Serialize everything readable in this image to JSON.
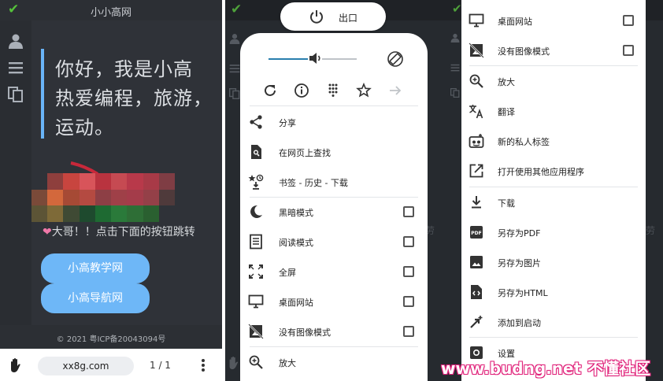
{
  "panel1": {
    "site_title": "小小高网",
    "greeting_lines": [
      "你好，我是小高",
      "热爱编程，旅游，",
      "运动。"
    ],
    "banner_text": "大哥！！点击下面的按钮跳转",
    "buttons": [
      "小高教学网",
      "小高导航网"
    ],
    "footer": "© 2021 粤ICP备20043094号",
    "url": "xx8g.com",
    "tab_count": "1 / 1"
  },
  "panel2": {
    "exit_label": "出口",
    "quick_actions": [
      "reload-icon",
      "info-icon",
      "apps-grid-icon",
      "star-icon",
      "forward-arrow-icon"
    ],
    "items": [
      {
        "label": "分享",
        "icon": "share-icon"
      },
      {
        "label": "在网页上查找",
        "icon": "find-in-page-icon"
      },
      {
        "label": "书签 - 历史 - 下载",
        "icon": "bookmark-history-icon"
      },
      {
        "label": "黑暗模式",
        "icon": "moon-icon",
        "checked": false
      },
      {
        "label": "阅读模式",
        "icon": "reader-icon",
        "checked": false
      },
      {
        "label": "全屏",
        "icon": "fullscreen-icon",
        "checked": false
      },
      {
        "label": "桌面网站",
        "icon": "desktop-icon",
        "checked": false
      },
      {
        "label": "没有图像模式",
        "icon": "no-image-icon",
        "checked": false
      },
      {
        "label": "放大",
        "icon": "zoom-in-icon"
      }
    ]
  },
  "panel3": {
    "items": [
      {
        "label": "桌面网站",
        "icon": "desktop-icon",
        "checked": false
      },
      {
        "label": "没有图像模式",
        "icon": "no-image-icon",
        "checked": false
      },
      {
        "label": "放大",
        "icon": "zoom-in-icon"
      },
      {
        "label": "翻译",
        "icon": "translate-icon"
      },
      {
        "label": "新的私人标签",
        "icon": "incognito-tab-icon"
      },
      {
        "label": "打开使用其他应用程序",
        "icon": "open-external-icon"
      },
      {
        "label": "下载",
        "icon": "download-icon"
      },
      {
        "label": "另存为PDF",
        "icon": "pdf-icon"
      },
      {
        "label": "另存为图片",
        "icon": "image-icon"
      },
      {
        "label": "另存为HTML",
        "icon": "html-file-icon"
      },
      {
        "label": "添加到启动",
        "icon": "add-to-launcher-icon"
      },
      {
        "label": "设置",
        "icon": "settings-icon"
      }
    ]
  },
  "watermark": {
    "url": "www.budng.net",
    "name": "不懂社区"
  },
  "colors": {
    "accent": "#6eb7f7",
    "dark_bg": "#2f3238",
    "check": "#55c13b",
    "watermark": "#e0227a"
  }
}
